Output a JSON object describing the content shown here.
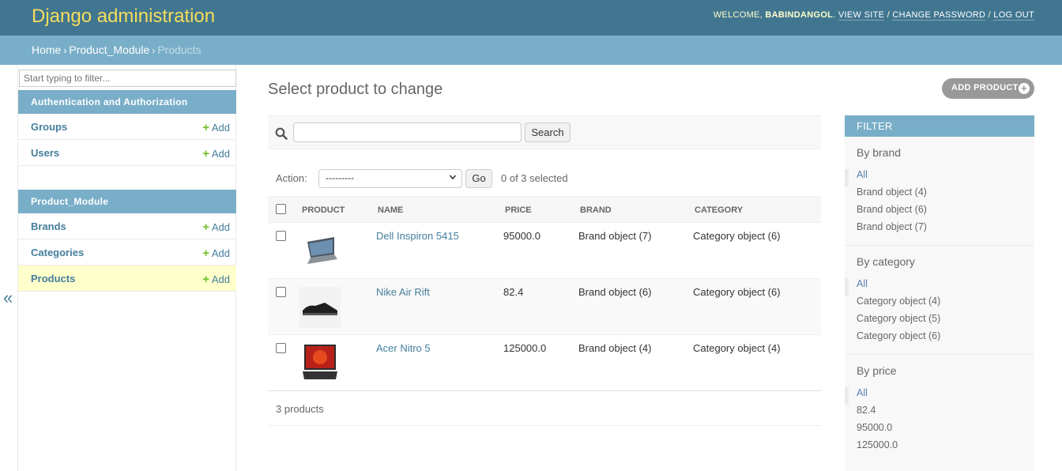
{
  "header": {
    "site_title": "Django administration",
    "welcome": "Welcome,",
    "username": "babindangol",
    "view_site": "View site",
    "change_password": "Change password",
    "log_out": "Log out"
  },
  "breadcrumbs": {
    "home": "Home",
    "module": "Product_Module",
    "current": "Products",
    "separator": "›"
  },
  "sidebar": {
    "filter_placeholder": "Start typing to filter...",
    "toggle": "«",
    "modules": [
      {
        "caption": "Authentication and Authorization",
        "rows": [
          {
            "label": "Groups",
            "add": "Add"
          },
          {
            "label": "Users",
            "add": "Add"
          }
        ]
      },
      {
        "caption": "Product_Module",
        "rows": [
          {
            "label": "Brands",
            "add": "Add"
          },
          {
            "label": "Categories",
            "add": "Add"
          },
          {
            "label": "Products",
            "add": "Add"
          }
        ]
      }
    ]
  },
  "main": {
    "title": "Select product to change",
    "add_button": "Add product",
    "search_button": "Search",
    "action_label": "Action:",
    "action_selected": "---------",
    "go_button": "Go",
    "counter": "0 of 3 selected",
    "columns": [
      "Product",
      "Name",
      "Price",
      "Brand",
      "Category"
    ],
    "rows": [
      {
        "name": "Dell Inspiron 5415",
        "price": "95000.0",
        "brand": "Brand object (7)",
        "category": "Category object (6)",
        "thumb": "laptop-thumbnail"
      },
      {
        "name": "Nike Air Rift",
        "price": "82.4",
        "brand": "Brand object (6)",
        "category": "Category object (6)",
        "thumb": "shoe-thumbnail"
      },
      {
        "name": "Acer Nitro 5",
        "price": "125000.0",
        "brand": "Brand object (4)",
        "category": "Category object (4)",
        "thumb": "gaming-laptop-thumbnail"
      }
    ],
    "paginator": "3 products"
  },
  "filter": {
    "title": "Filter",
    "groups": [
      {
        "heading": "By brand",
        "items": [
          "All",
          "Brand object (4)",
          "Brand object (6)",
          "Brand object (7)"
        ]
      },
      {
        "heading": "By category",
        "items": [
          "All",
          "Category object (4)",
          "Category object (5)",
          "Category object (6)"
        ]
      },
      {
        "heading": "By price",
        "items": [
          "All",
          "82.4",
          "95000.0",
          "125000.0"
        ]
      }
    ]
  },
  "colors": {
    "header": "#417690",
    "breadcrumbs": "#79aec8",
    "brand_title": "#f5dd5d",
    "link": "#447e9b",
    "add_plus": "#70bf2b",
    "current_row": "#ffffcc"
  },
  "icons": [
    "search-icon",
    "plus-icon",
    "chevron-down-icon"
  ]
}
